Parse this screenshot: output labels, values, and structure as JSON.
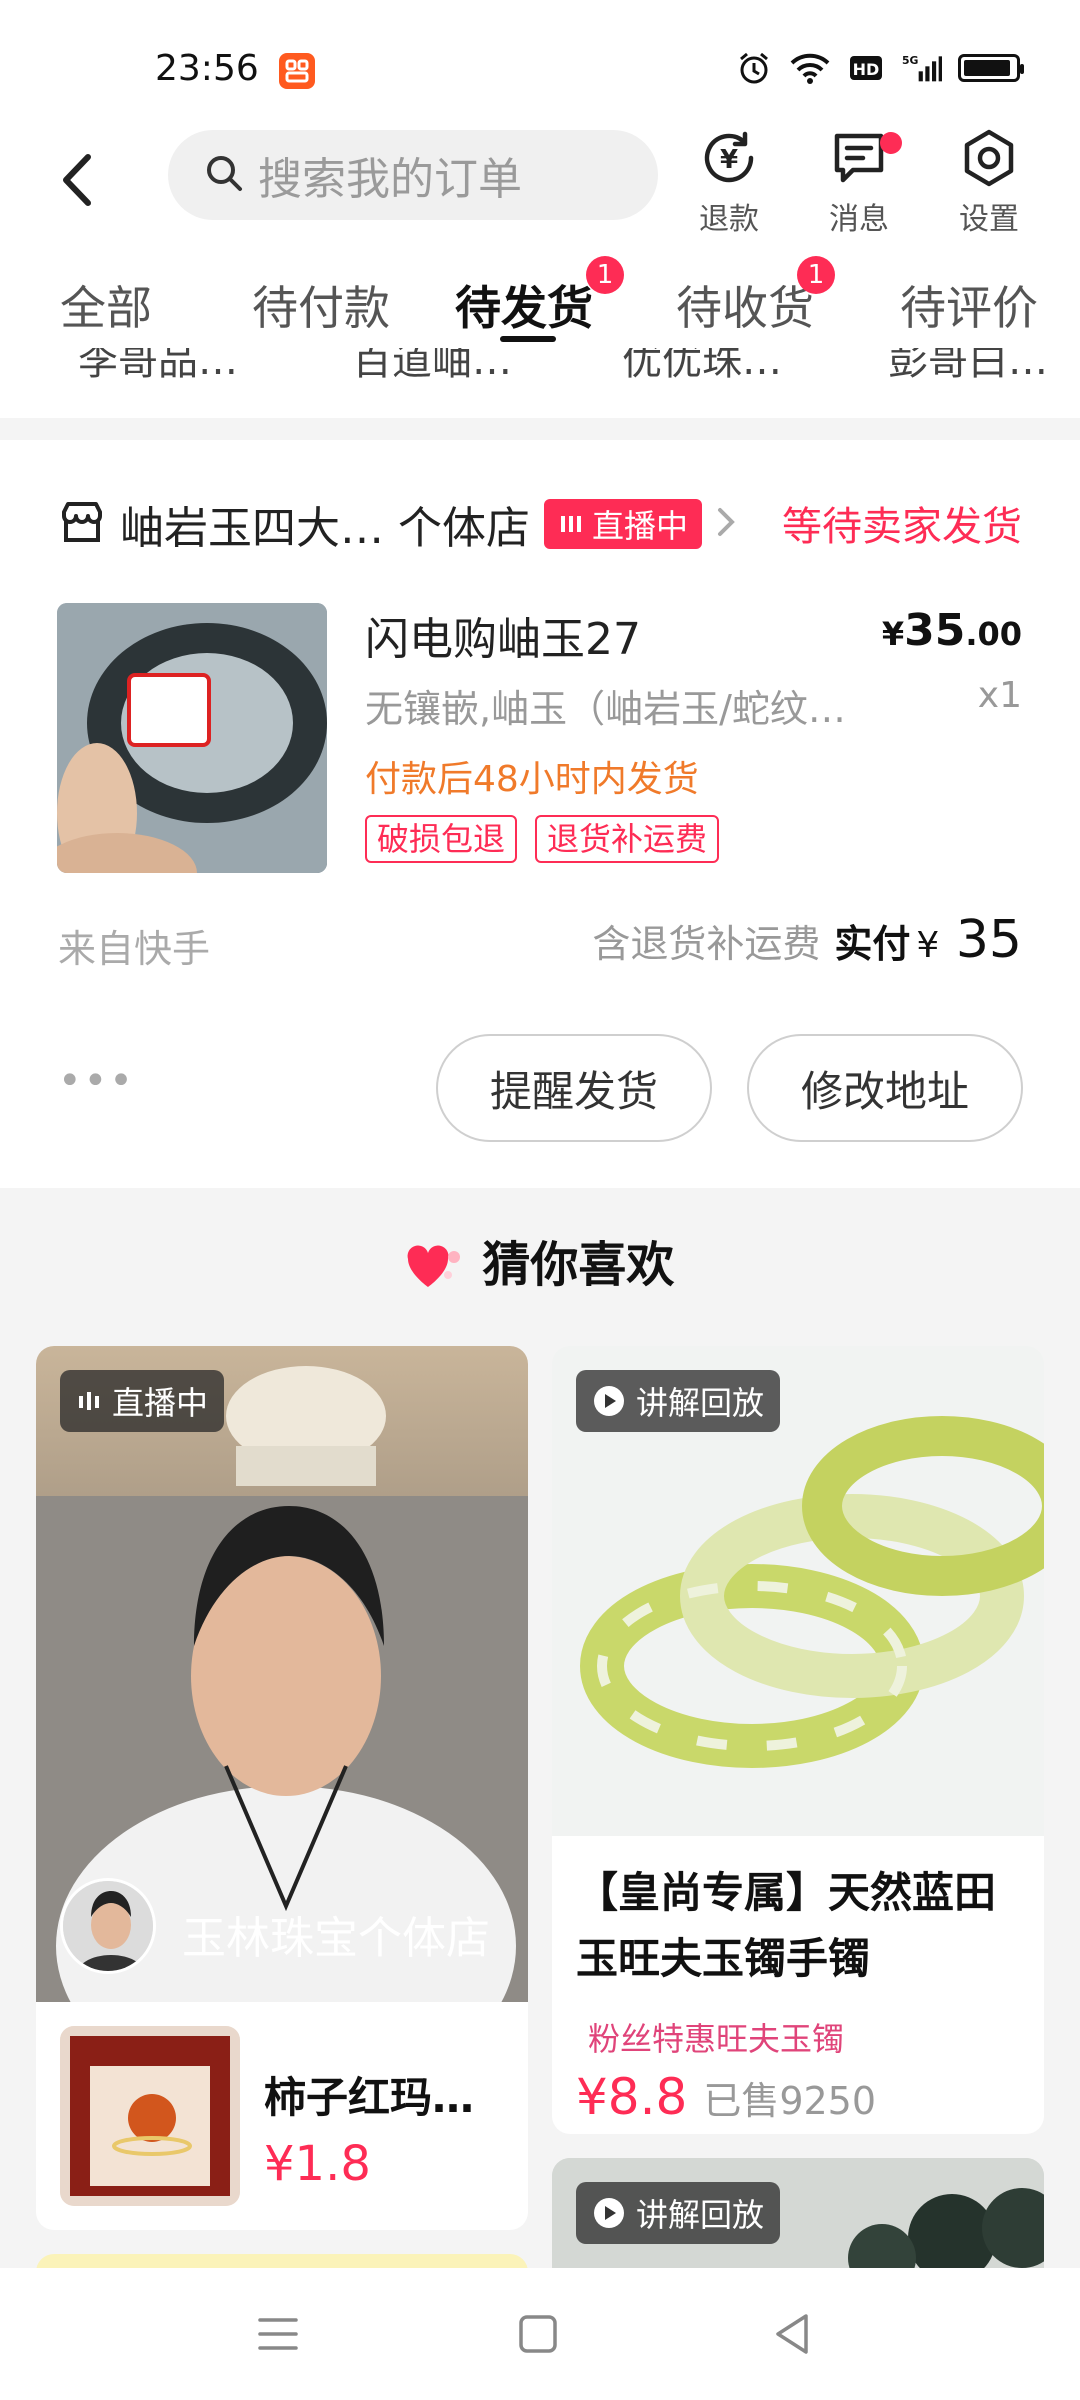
{
  "status_bar": {
    "time": "23:56"
  },
  "header": {
    "search_placeholder": "搜索我的订单",
    "refund_label": "退款",
    "message_label": "消息",
    "settings_label": "设置"
  },
  "tabs": [
    {
      "label": "全部"
    },
    {
      "label": "待付款"
    },
    {
      "label": "待发货",
      "badge": "1"
    },
    {
      "label": "待收货",
      "badge": "1"
    },
    {
      "label": "待评价"
    }
  ],
  "peek_row": [
    "李哥品…",
    "百道岫…",
    "优优珠…",
    "彭哥白…"
  ],
  "order": {
    "store_name": "岫岩玉四大… 个体店",
    "live_badge": "直播中",
    "status": "等待卖家发货",
    "title": "闪电购岫玉27",
    "spec": "无镶嵌,岫玉（岫岩玉/蛇纹…",
    "ship_note": "付款后48小时内发货",
    "tags": [
      "破损包退",
      "退货补运费"
    ],
    "price_currency": "¥",
    "price_int": "35",
    "price_dec": ".00",
    "quantity": "x1",
    "source": "来自快手",
    "shipping_note": "含退货补运费",
    "paid_label": "实付",
    "paid_currency": "¥",
    "paid_amount": "35",
    "remind_button": "提醒发货",
    "edit_address_button": "修改地址"
  },
  "recommend": {
    "section_title": "猜你喜欢",
    "card1": {
      "badge": "直播中",
      "shop_name": "玉林珠宝个体店",
      "product_title": "柿子红玛…",
      "price": "¥1.8"
    },
    "card2": {
      "badge": "讲解回放",
      "title": "【皇尚专属】天然蓝田玉旺夫玉镯手镯",
      "promo": "粉丝特惠旺夫玉镯",
      "price": "¥8.8",
      "sold": "已售9250"
    },
    "card3": {
      "badge": "讲解回放"
    }
  },
  "colors": {
    "accent": "#fe2c55",
    "ship_note": "#f07a2a"
  }
}
